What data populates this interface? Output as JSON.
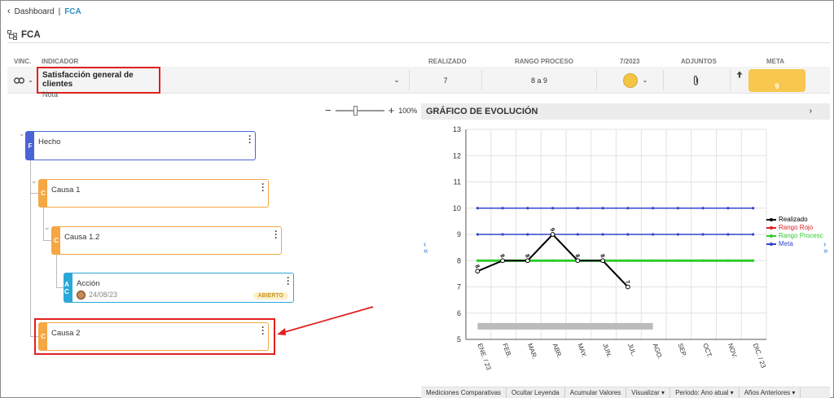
{
  "breadcrumb": {
    "back": "Dashboard",
    "current": "FCA"
  },
  "page_title": "FCA",
  "headers": {
    "vinc": "VINC.",
    "indicador": "INDICADOR",
    "realizado": "REALIZADO",
    "rango": "RANGO PROCESO",
    "period": "7/2023",
    "adjuntos": "ADJUNTOS",
    "meta": "META"
  },
  "row": {
    "indicator_title": "Satisfacción general de clientes",
    "indicator_sub": "Nota",
    "realizado": "7",
    "rango": "8 a 9",
    "meta": "9",
    "status_color": "#f4c542"
  },
  "zoom": {
    "percent": "100%",
    "minus": "−",
    "plus": "+",
    "level": 0.5
  },
  "tree": {
    "hecho": {
      "letter": "F",
      "label": "Hecho"
    },
    "causa1": {
      "letter": "C",
      "label": "Causa 1"
    },
    "causa12": {
      "letter": "C",
      "label": "Causa 1.2"
    },
    "accion": {
      "letters": "A C",
      "label": "Acción",
      "date": "24/08/23",
      "badge": "ABIERTO"
    },
    "causa2": {
      "letter": "C",
      "label": "Causa 2"
    }
  },
  "chart_title": "GRÁFICO DE EVOLUCIÓN",
  "footer": [
    "Mediciones Comparativas",
    "Ocultar Leyenda",
    "Acumular Valores",
    "Visualizar ▾",
    "Periodo: Ano atual ▾",
    "Años Anteriores ▾"
  ],
  "chart_data": {
    "type": "line",
    "categories": [
      "ENE. / 23",
      "FEB.",
      "MAR.",
      "ABR.",
      "MAY.",
      "JUN.",
      "JUL.",
      "AGO.",
      "SEP.",
      "OCT.",
      "NOV.",
      "DIC. / 23"
    ],
    "ylim": [
      5,
      13
    ],
    "yticks": [
      5,
      6,
      7,
      8,
      9,
      10,
      11,
      12,
      13
    ],
    "grid": true,
    "legend_position": "right",
    "series": [
      {
        "name": "Realizado",
        "color": "#000000",
        "values": [
          7.6,
          8,
          8,
          9,
          8,
          8,
          7,
          null,
          null,
          null,
          null,
          null
        ],
        "labels": [
          "8",
          "8",
          "8",
          "9",
          "8",
          "8",
          "7"
        ]
      },
      {
        "name": "Rango Rojo",
        "color": "#e02020",
        "values": [
          8,
          8,
          8,
          8,
          8,
          8,
          8,
          8,
          8,
          8,
          8,
          8
        ]
      },
      {
        "name": "Rango Procesc",
        "color": "#2ecc2e",
        "values": [
          8,
          8,
          8,
          8,
          8,
          8,
          8,
          8,
          8,
          8,
          8,
          8
        ]
      },
      {
        "name": "Meta",
        "color": "#3344cc",
        "values": [
          9,
          9,
          9,
          9,
          9,
          9,
          9,
          9,
          9,
          9,
          9,
          9
        ]
      }
    ],
    "extra_line": {
      "color": "#3344cc",
      "values": [
        10,
        10,
        10,
        10,
        10,
        10,
        10,
        10,
        10,
        10,
        10,
        10
      ]
    },
    "bar_band": {
      "from_index": 0,
      "to_index": 7,
      "value": 5.5,
      "color": "#bbbbbb"
    }
  }
}
